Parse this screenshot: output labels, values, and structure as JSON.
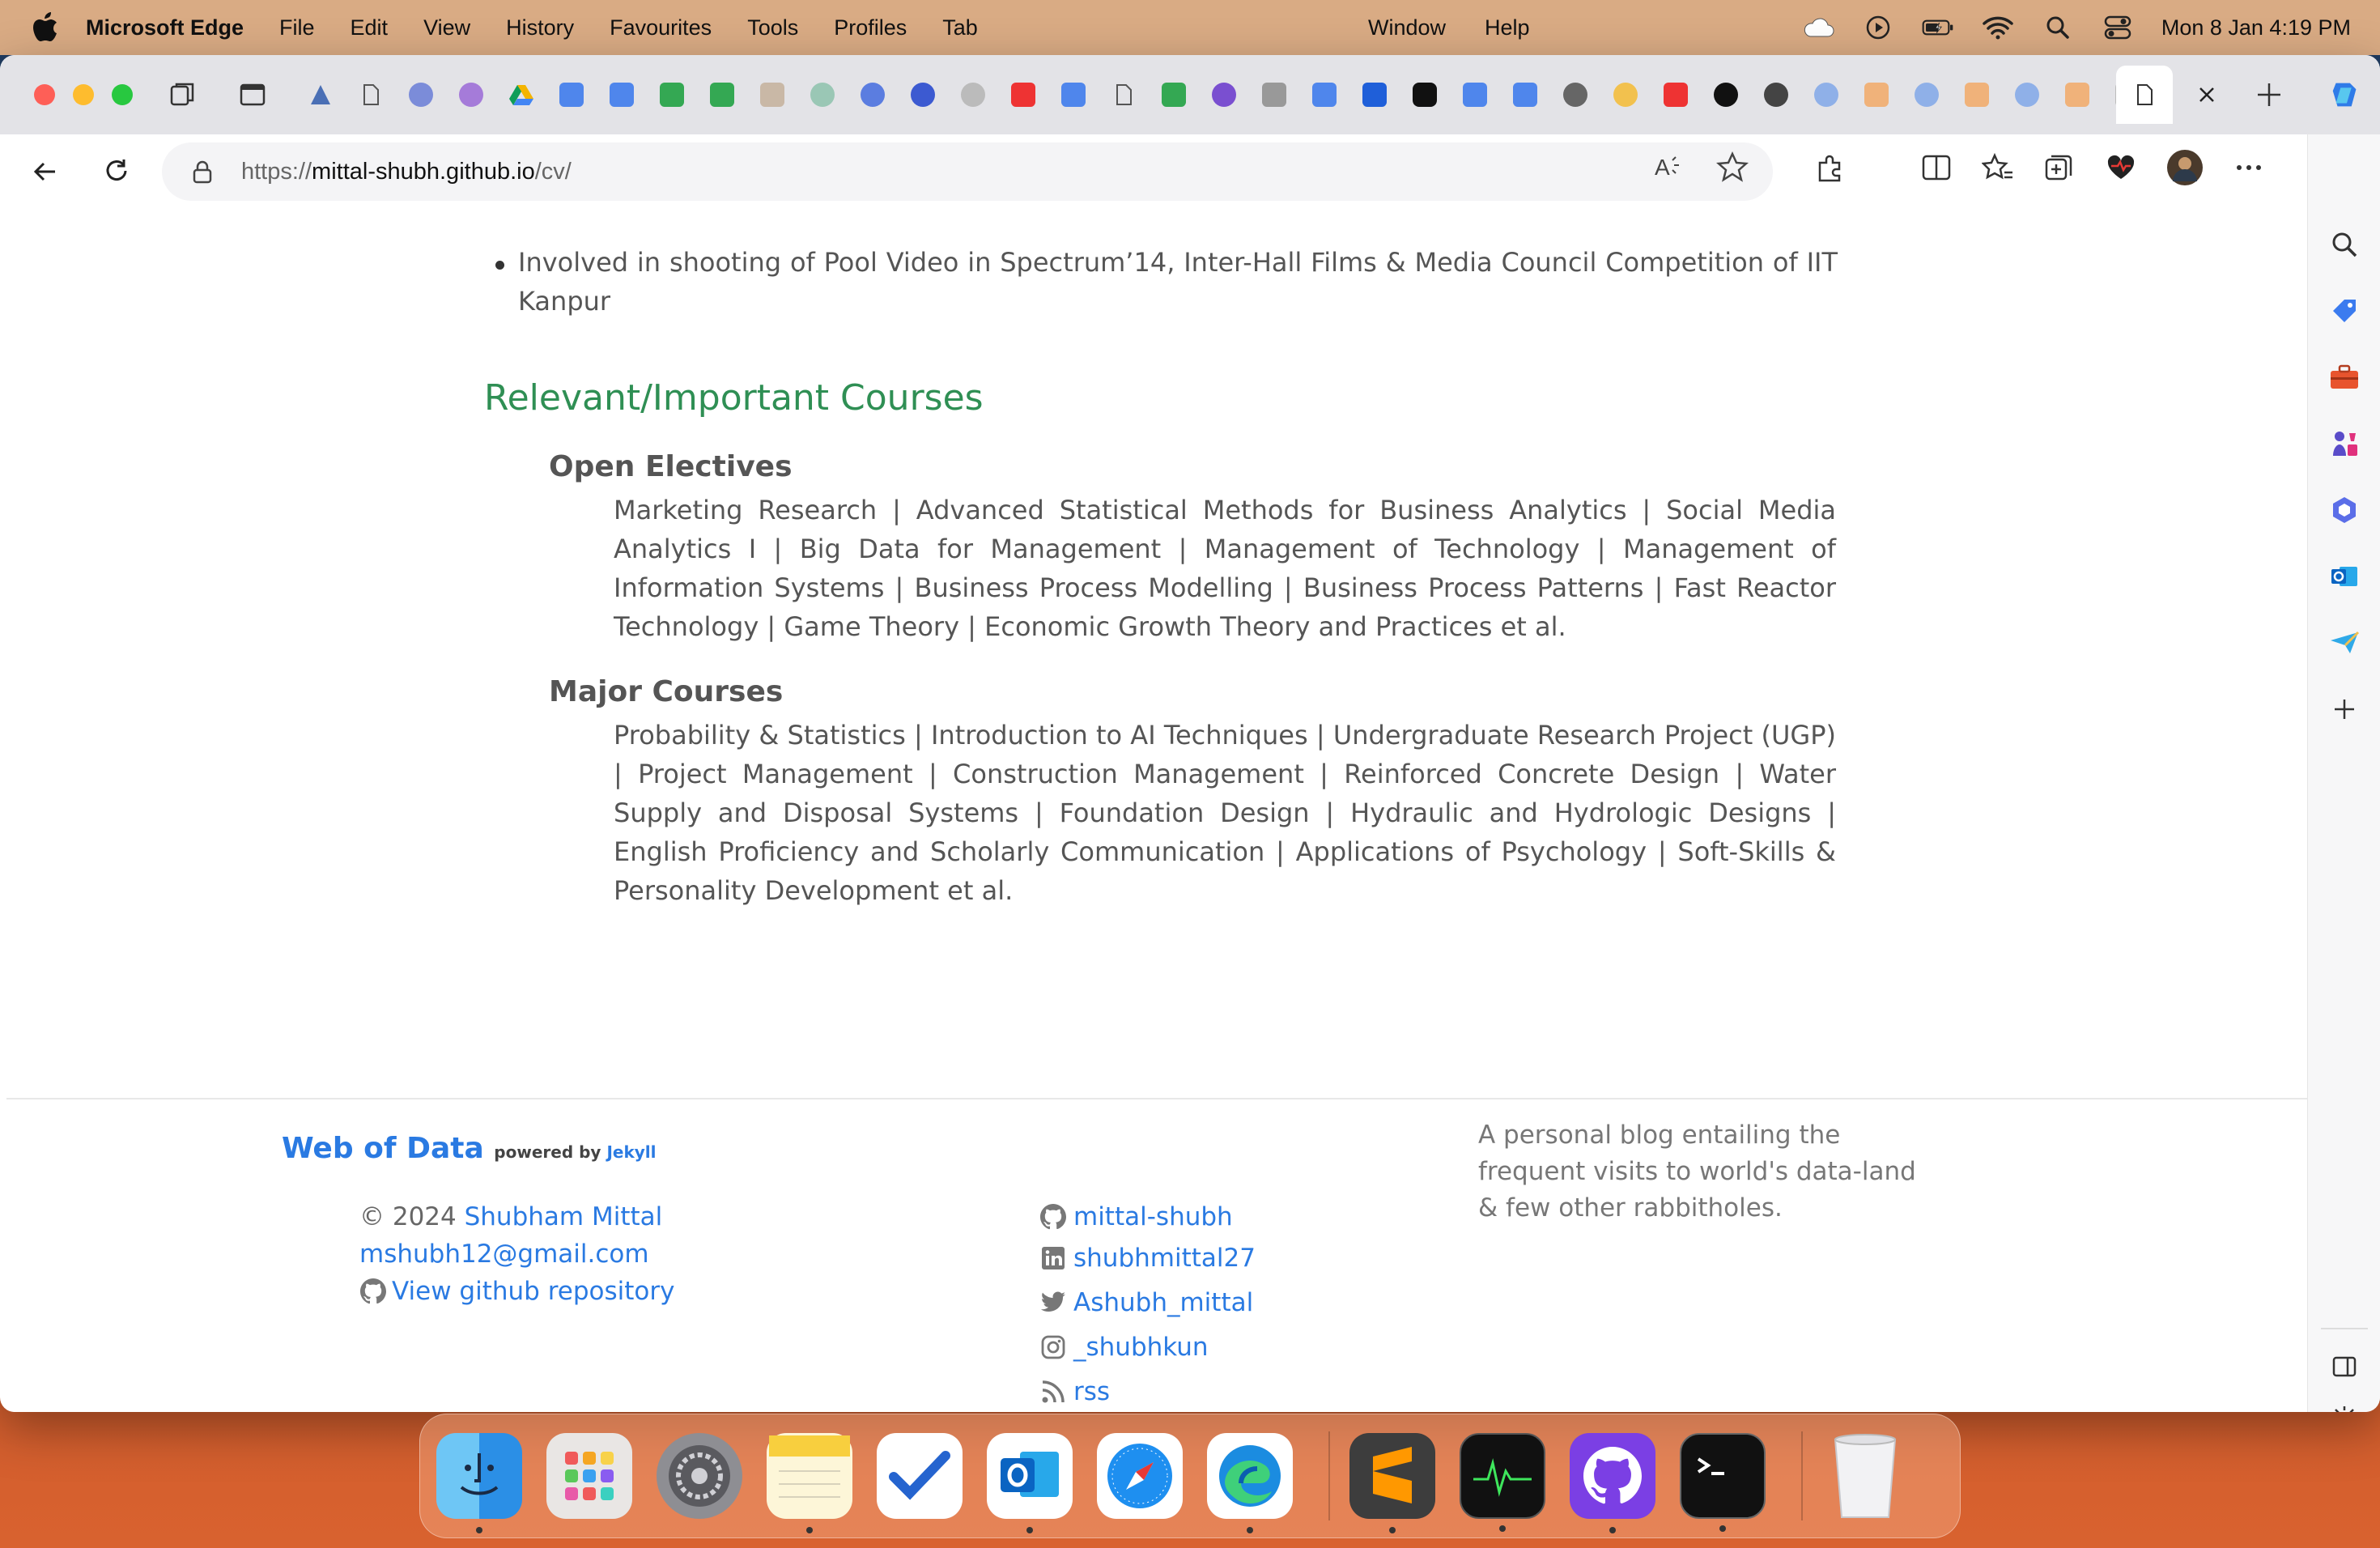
{
  "menubar": {
    "app_name": "Microsoft Edge",
    "items": [
      "File",
      "Edit",
      "View",
      "History",
      "Favourites",
      "Tools",
      "Profiles",
      "Tab"
    ],
    "center_items": [
      "Window",
      "Help"
    ],
    "datetime": "Mon 8 Jan  4:19 PM"
  },
  "browser": {
    "url_prefix": "https://",
    "url_host": "mittal-shubh.github.io",
    "url_path": "/cv/"
  },
  "content": {
    "bullet_text": "Involved in shooting of Pool Video in Spectrum’14, Inter-Hall Films & Media Council Competition of IIT Kanpur",
    "section_title": "Relevant/Important Courses",
    "open_electives_title": "Open Electives",
    "open_electives_text": "Marketing Research | Advanced Statistical Methods for Business Analytics | Social Media Analytics I | Big Data for Management | Management of Technology | Management of Information Systems | Business Process Modelling | Business Process Patterns | Fast Reactor Technology | Game Theory | Economic Growth Theory and Practices et al.",
    "major_courses_title": "Major Courses",
    "major_courses_text": "Probability & Statistics | Introduction to AI Techniques | Undergraduate Research Project (UGP) | Project Management | Construction Management | Reinforced Concrete Design | Water Supply and Disposal Systems | Foundation Design | Hydraulic and Hydrologic Designs | English Proficiency and Scholarly Communication | Applications of Psychology | Soft-Skills & Personality Development et al."
  },
  "footer": {
    "site_title": "Web of Data",
    "powered_by": "powered by",
    "jekyll": "Jekyll",
    "copyright": "© 2024",
    "author": "Shubham Mittal",
    "email": "mshubh12@gmail.com",
    "github_repo": "View github repository",
    "social": {
      "github": "mittal-shubh",
      "linkedin": "shubhmittal27",
      "twitter": "Ashubh_mittal",
      "instagram": "_shubhkun",
      "rss": "rss"
    },
    "description": "A personal blog entailing the frequent visits to world's data-land & few other rabbitholes."
  },
  "colors": {
    "link": "#2a7ae2",
    "section_title": "#2f8f54",
    "menubar": "#d9ab84"
  }
}
